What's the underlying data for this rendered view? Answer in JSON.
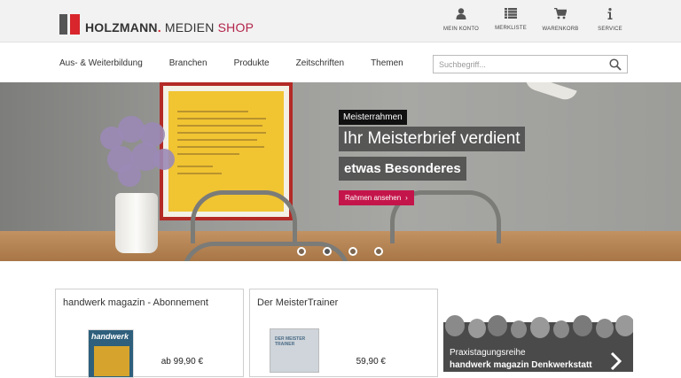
{
  "header": {
    "logo": {
      "brand": "HOLZMANN",
      "dot": ".",
      "medien": " MEDIEN",
      "shop": " SHOP"
    },
    "icons": [
      {
        "icon": "user-icon",
        "label": "MEIN KONTO"
      },
      {
        "icon": "list-icon",
        "label": "MERKLISTE"
      },
      {
        "icon": "cart-icon",
        "label": "WARENKORB"
      },
      {
        "icon": "info-icon",
        "label": "SERVICE"
      }
    ]
  },
  "nav": {
    "items": [
      "Aus- & Weiterbildung",
      "Branchen",
      "Produkte",
      "Zeitschriften",
      "Themen"
    ],
    "search_placeholder": "Suchbegriff..."
  },
  "hero": {
    "tag": "Meisterrahmen",
    "title": "Ihr Meisterbrief verdient",
    "subtitle": "etwas Besonderes",
    "button": "Rahmen ansehen",
    "slides": 4,
    "active_slide": 2
  },
  "cards": [
    {
      "title": "handwerk magazin - Abonnement",
      "price": "ab 99,90 €",
      "cover_text": "handwerk"
    },
    {
      "title": "Der MeisterTrainer",
      "price": "59,90 €",
      "cover_text": "DER MEISTER TRAINER"
    },
    {
      "line1": "Praxistagungsreihe",
      "line2": "handwerk magazin Denkwerkstatt"
    }
  ],
  "colors": {
    "accent": "#c4154a",
    "brand_red": "#d8262c",
    "shop_pink": "#b3244a"
  }
}
